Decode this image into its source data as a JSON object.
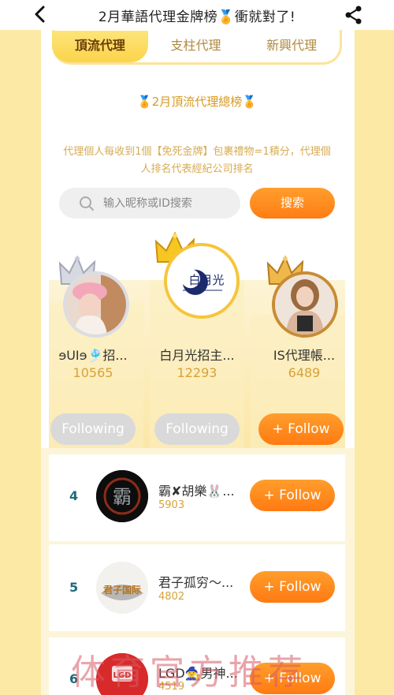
{
  "navbar": {
    "title": "2月華語代理金牌榜🏅衝就對了!",
    "back_icon": "back-arrow-icon",
    "share_icon": "share-icon"
  },
  "tabs": [
    {
      "label": "頂流代理",
      "active": true
    },
    {
      "label": "支柱代理",
      "active": false
    },
    {
      "label": "新興代理",
      "active": false
    }
  ],
  "board": {
    "title": "🏅2月頂流代理總榜🏅",
    "description": "代理個人每收到1個【免死金牌】包裹禮物=1積分，代理個人排名代表經紀公司排名"
  },
  "search": {
    "placeholder": "输入昵称或ID搜索",
    "button_label": "搜索"
  },
  "podium": [
    {
      "rank": 2,
      "name": "ɘUIɘ🎐招...",
      "score": "10565",
      "button": "Following",
      "following": true,
      "crown": "silver-crown"
    },
    {
      "rank": 1,
      "name": "白月光招主...",
      "score": "12293",
      "button": "Following",
      "following": true,
      "crown": "gold-crown",
      "logo_text": "白月光"
    },
    {
      "rank": 3,
      "name": "IS代理帳...",
      "score": "6489",
      "button": "+ Follow",
      "following": false,
      "crown": "bronze-crown"
    }
  ],
  "list": [
    {
      "rank": "4",
      "name": "霸✘胡樂🐰...",
      "score": "5903",
      "button": "+ Follow",
      "avatar_text": "霸"
    },
    {
      "rank": "5",
      "name": "君子孤穷～...",
      "score": "4802",
      "button": "+ Follow",
      "avatar_text": "君子国际"
    },
    {
      "rank": "6",
      "name": "LGD🧙男神...",
      "score": "4519",
      "button": "+ Follow",
      "avatar_text": "LGD"
    }
  ],
  "watermark": "体育官方推荐",
  "colors": {
    "accent_orange": "#ff8a1e",
    "gold_text": "#d6a23a",
    "tab_active": "#fbd44a",
    "rank_number": "#1d6a7a"
  }
}
